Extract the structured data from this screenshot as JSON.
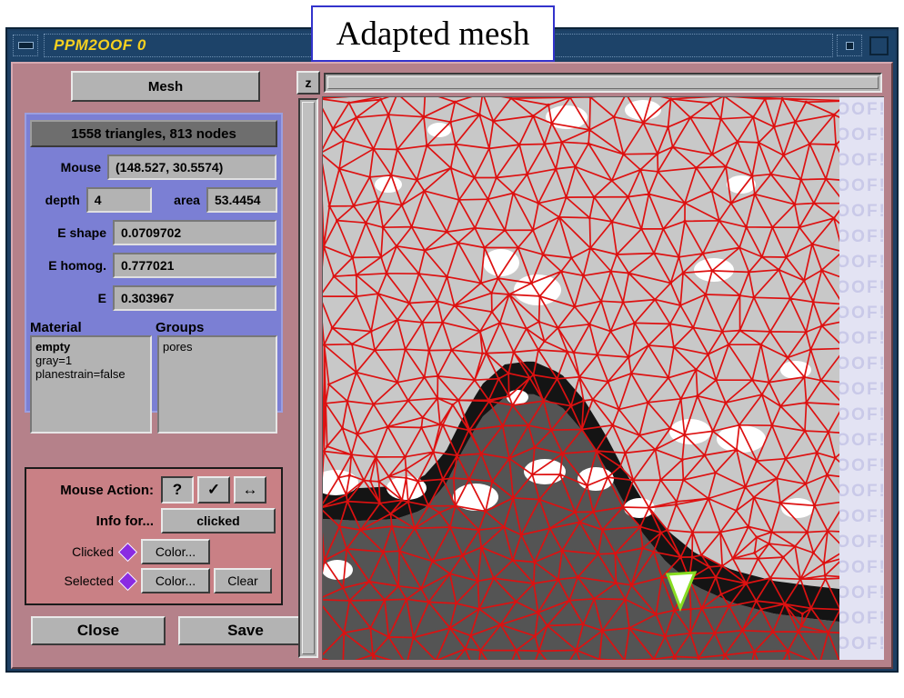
{
  "window": {
    "title": "PPM2OOF 0",
    "minimize_icon": "minimize-icon",
    "maximize_icon": "maximize-icon",
    "restore_icon": "restore-icon"
  },
  "caption": {
    "text": "Adapted mesh"
  },
  "left_panel": {
    "mesh_button": "Mesh",
    "triangle_count": "1558 triangles, 813 nodes",
    "fields": [
      {
        "label": "Mouse",
        "value": "(148.527, 30.5574)"
      },
      {
        "label": "depth",
        "value": "4"
      },
      {
        "label": "area",
        "value": "53.4454"
      },
      {
        "label": "E shape",
        "value": "0.0709702"
      },
      {
        "label": "E homog.",
        "value": "0.777021"
      },
      {
        "label": "E",
        "value": "0.303967"
      }
    ],
    "material": {
      "label": "Material",
      "name": "empty",
      "lines": [
        "gray=1",
        "planestrain=false"
      ]
    },
    "groups": {
      "label": "Groups",
      "items": [
        "pores"
      ]
    },
    "mouse_action": {
      "label": "Mouse Action:",
      "buttons": [
        {
          "name": "query",
          "glyph": "?"
        },
        {
          "name": "select",
          "glyph": "✓"
        },
        {
          "name": "move",
          "glyph": "↔"
        }
      ],
      "info_for_label": "Info for...",
      "info_for_value": "clicked",
      "clicked_label": "Clicked",
      "clicked_color_button": "Color...",
      "selected_label": "Selected",
      "selected_color_button": "Color...",
      "clear_button": "Clear",
      "swatch_color": "#8a2be2"
    },
    "close_button": "Close",
    "save_button": "Save"
  },
  "mesh_panel": {
    "zoom_button": "z",
    "watermark_text": "OOF!",
    "mesh_edge_color": "#dd1111",
    "highlight_edge_color": "#88dd22",
    "highlight_fill_color": "#ffffff",
    "region_colors": {
      "matrix": "#c8c8c8",
      "pore": "#ffffff",
      "dark_phase": "#141414",
      "substrate": "#545454",
      "background": "#e3e3f3"
    }
  }
}
